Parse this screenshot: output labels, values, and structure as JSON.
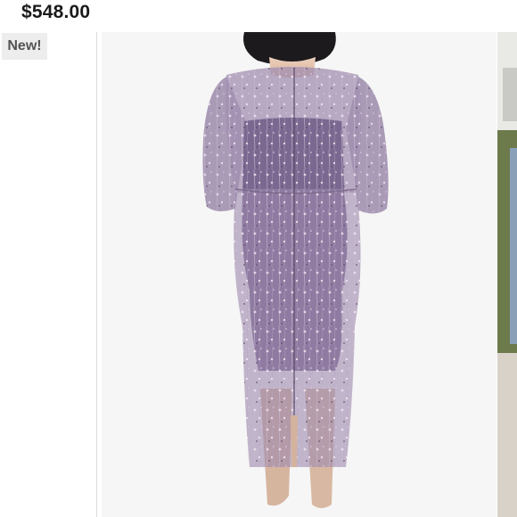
{
  "listing": {
    "price": "$548.00",
    "badge": "New!"
  },
  "colors": {
    "dress": "#8f7ba0",
    "dress_lining": "#7a6890",
    "background": "#f6f6f6",
    "skin": "#e3c3ad",
    "hair": "#1c1a1c"
  }
}
